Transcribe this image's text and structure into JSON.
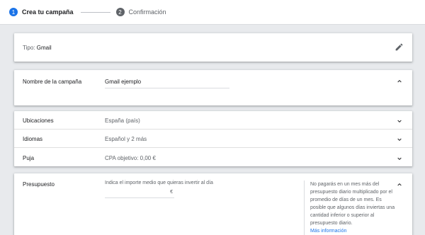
{
  "stepper": {
    "step1": {
      "number": "1",
      "label": "Crea tu campaña"
    },
    "step2": {
      "number": "2",
      "label": "Confirmación"
    }
  },
  "tipo": {
    "prefix": "Tipo:",
    "value": "Gmail"
  },
  "nombre": {
    "label": "Nombre de la campaña",
    "value": "Gmail ejemplo"
  },
  "ubicaciones": {
    "label": "Ubicaciones",
    "value": "España (país)"
  },
  "idiomas": {
    "label": "Idiomas",
    "value": "Español y 2 más"
  },
  "puja": {
    "label": "Puja",
    "value": "CPA objetivo: 0,00 €"
  },
  "presupuesto": {
    "label": "Presupuesto",
    "hint": "Indica el importe medio que quieras invertir al día",
    "currency": "€",
    "info": "No pagarás en un mes más del presupuesto diario multiplicado por el promedio de días de un mes. Es posible que algunos días inviertas una cantidad inferior o superior al presupuesto diario.",
    "link": "Más información"
  },
  "colors": {
    "accent": "#1a73e8",
    "muted": "#5f6368",
    "background": "#e8eaed"
  },
  "icons": {
    "edit": "pencil-icon",
    "expand": "chevron-down-icon",
    "collapse": "chevron-up-icon"
  }
}
